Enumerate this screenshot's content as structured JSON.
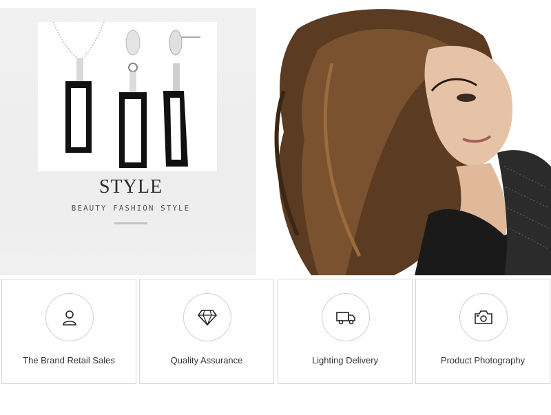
{
  "hero": {
    "title": "STYLE",
    "subtitle": "BEAUTY FASHION STYLE",
    "product_image_icon": "jewelry-set-image",
    "model_image_icon": "model-portrait-image"
  },
  "features": [
    {
      "label": "The Brand Retail Sales",
      "icon": "user-icon"
    },
    {
      "label": "Quality Assurance",
      "icon": "diamond-icon"
    },
    {
      "label": "Lighting Delivery",
      "icon": "truck-icon"
    },
    {
      "label": "Product Photography",
      "icon": "camera-icon"
    }
  ],
  "colors": {
    "card_border": "#d6d6d6",
    "text": "#333333",
    "hero_left_bg": "#efefef"
  }
}
